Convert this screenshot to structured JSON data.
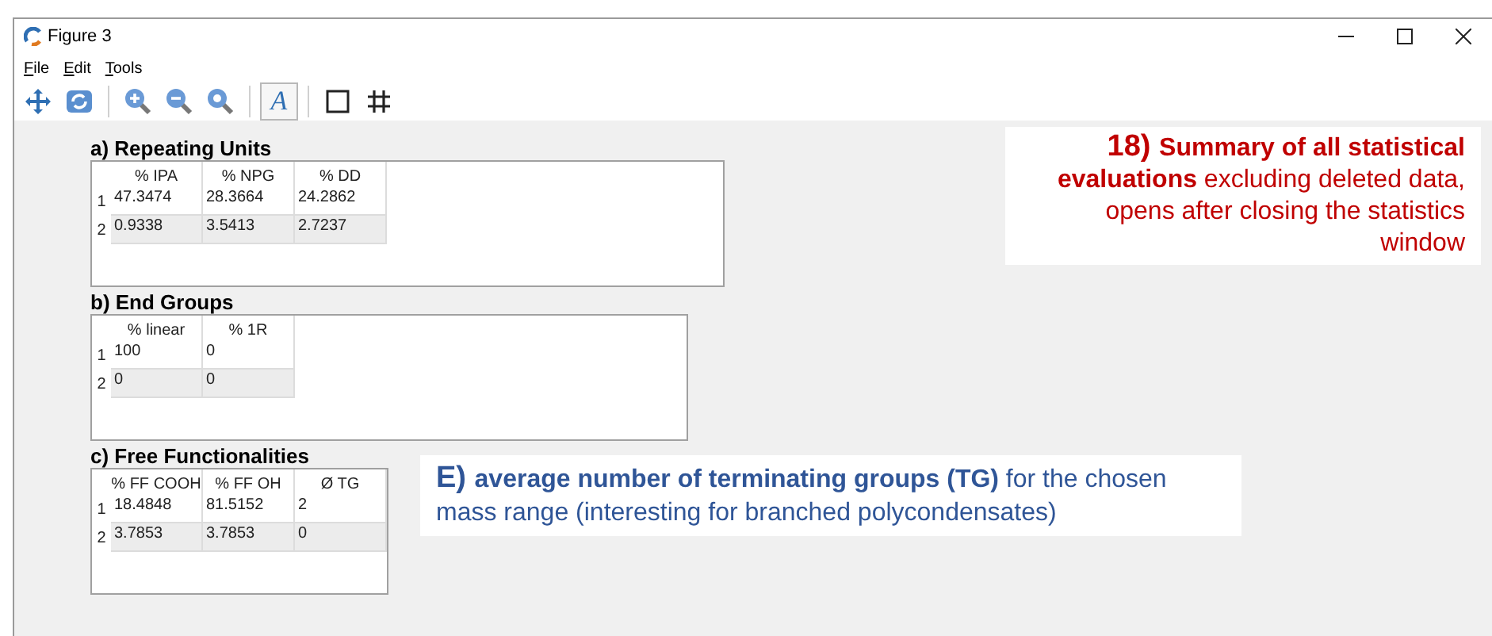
{
  "window": {
    "title": "Figure 3"
  },
  "menu": [
    {
      "label": "File"
    },
    {
      "label": "Edit"
    },
    {
      "label": "Tools"
    }
  ],
  "toolbar": [
    {
      "kind": "pan",
      "pressed": false
    },
    {
      "kind": "refresh",
      "pressed": false
    },
    {
      "kind": "sep"
    },
    {
      "kind": "zoom-in",
      "pressed": false
    },
    {
      "kind": "zoom-out",
      "pressed": false
    },
    {
      "kind": "zoom-reset",
      "pressed": false
    },
    {
      "kind": "sep"
    },
    {
      "kind": "text",
      "label": "A",
      "pressed": true
    },
    {
      "kind": "sep"
    },
    {
      "kind": "frame",
      "pressed": false
    },
    {
      "kind": "grid",
      "pressed": false
    }
  ],
  "tables": [
    {
      "title": "a) Repeating Units",
      "columns": [
        "% IPA",
        "% NPG",
        "% DD"
      ],
      "rows": [
        {
          "header": "1",
          "cells": [
            "47.3474",
            "28.3664",
            "24.2862"
          ]
        },
        {
          "header": "2",
          "cells": [
            "0.9338",
            "3.5413",
            "2.7237"
          ]
        }
      ]
    },
    {
      "title": "b) End Groups",
      "columns": [
        "% linear",
        "% 1R"
      ],
      "rows": [
        {
          "header": "1",
          "cells": [
            "100",
            "0"
          ]
        },
        {
          "header": "2",
          "cells": [
            "0",
            "0"
          ]
        }
      ]
    },
    {
      "title": "c) Free Functionalities",
      "columns": [
        "% FF COOH",
        "% FF OH",
        "Ø TG"
      ],
      "rows": [
        {
          "header": "1",
          "cells": [
            "18.4848",
            "81.5152",
            "2"
          ]
        },
        {
          "header": "2",
          "cells": [
            "3.7853",
            "3.7853",
            "0"
          ]
        }
      ]
    }
  ],
  "annotations": [
    {
      "number": "18)",
      "text": "**Summary of all statistical evaluations** excluding deleted data, opens after closing the statistics window",
      "color": "#c00000"
    },
    {
      "number": "E)",
      "text": "**average number of terminating groups (TG)** for the chosen mass range (interesting for branched polycondensates)",
      "color": "#2f5597"
    }
  ]
}
